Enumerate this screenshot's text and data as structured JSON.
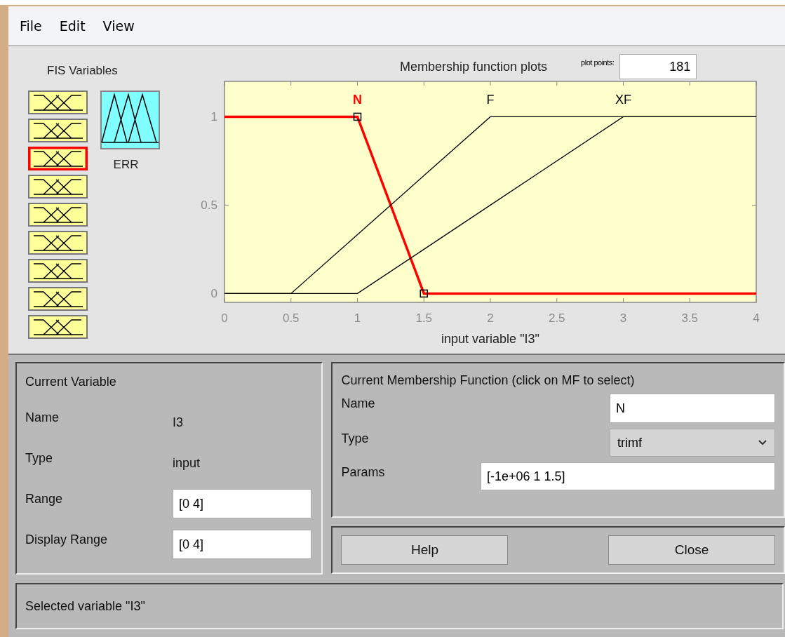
{
  "menu": [
    "File",
    "Edit",
    "View"
  ],
  "fis_variables": {
    "title": "FIS Variables",
    "inputs": [
      {
        "selected": false
      },
      {
        "selected": false
      },
      {
        "selected": true
      },
      {
        "selected": false
      },
      {
        "selected": false
      },
      {
        "selected": false
      },
      {
        "selected": false
      },
      {
        "selected": false
      },
      {
        "selected": false
      }
    ],
    "output": {
      "label": "ERR",
      "selected": false
    }
  },
  "plot": {
    "title": "Membership function plots",
    "plot_points_label": "plot points:",
    "plot_points": "181",
    "chart_data": {
      "type": "line",
      "xlabel": "input variable \"I3\"",
      "x": [
        0,
        0.5,
        1,
        1.5,
        2,
        3,
        4
      ],
      "xlim": [
        0,
        4
      ],
      "ylim": [
        -0.05,
        1.2
      ],
      "xticks": [
        0,
        0.5,
        1,
        1.5,
        2,
        2.5,
        3,
        3.5,
        4
      ],
      "yticks": [
        0,
        0.5,
        1
      ],
      "series": [
        {
          "name": "N",
          "color": "#ff0000",
          "values": [
            1,
            1,
            1,
            0,
            0,
            0,
            0
          ]
        },
        {
          "name": "F",
          "color": "#000000",
          "values": [
            0,
            0,
            0.333,
            0.667,
            1,
            1,
            1
          ]
        },
        {
          "name": "XF",
          "color": "#000000",
          "values": [
            0,
            0,
            0,
            0.25,
            0.5,
            1,
            1
          ]
        }
      ]
    },
    "membership_functions": [
      {
        "selected": true
      },
      {
        "selected": false
      },
      {
        "selected": false
      }
    ]
  },
  "current_variable": {
    "title": "Current Variable",
    "name_label": "Name",
    "name": "I3",
    "type_label": "Type",
    "type": "input",
    "range_label": "Range",
    "range": "[0 4]",
    "display_range_label": "Display Range",
    "display_range": "[0 4]"
  },
  "current_mf": {
    "title": "Current Membership Function (click on MF to select)",
    "name_label": "Name",
    "name": "N",
    "type_label": "Type",
    "type": "trimf",
    "params_label": "Params",
    "params": "[-1e+06 1 1.5]"
  },
  "buttons": [
    "Help",
    "Close"
  ],
  "status": "Selected variable \"I3\""
}
